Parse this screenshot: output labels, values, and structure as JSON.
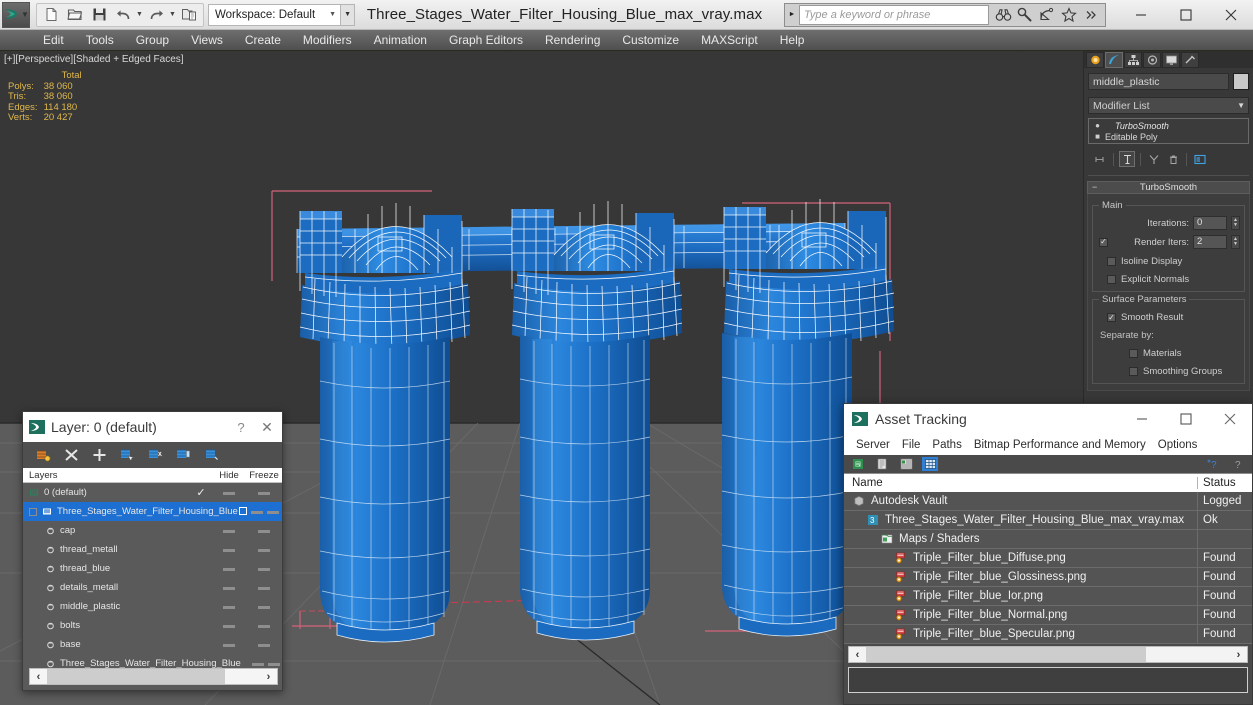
{
  "app": {
    "title": "Three_Stages_Water_Filter_Housing_Blue_max_vray.max",
    "workspace": "Workspace: Default",
    "logo_icon": "max-logo-icon"
  },
  "search": {
    "placeholder": "Type a keyword or phrase",
    "value": "",
    "icons": [
      "binoculars-icon",
      "wrench-icon",
      "satellite-icon",
      "star-icon",
      "more-icon"
    ]
  },
  "window_controls": {
    "minimize": "–",
    "maximize": "□",
    "close": "✕"
  },
  "quick_access": [
    "new-file-icon",
    "open-file-icon",
    "save-icon",
    "undo-icon",
    "redo-icon",
    "set-project-icon"
  ],
  "menubar": {
    "items": [
      "Edit",
      "Tools",
      "Group",
      "Views",
      "Create",
      "Modifiers",
      "Animation",
      "Graph Editors",
      "Rendering",
      "Customize",
      "MAXScript",
      "Help"
    ]
  },
  "viewport": {
    "label": "[+][Perspective][Shaded + Edged Faces]",
    "stats_header": "Total",
    "stats": [
      {
        "key": "Polys:",
        "value": "38 060"
      },
      {
        "key": "Tris:",
        "value": "38 060"
      },
      {
        "key": "Edges:",
        "value": "114 180"
      },
      {
        "key": "Verts:",
        "value": "20 427"
      }
    ],
    "colors": {
      "sky": "#373737",
      "floor": "#5c5c5c",
      "grid": "#6a6a6a",
      "model_blue": "#1f6fc4",
      "wire": "#ffffff",
      "gizmo_pink": "#d1627a"
    }
  },
  "command_panel": {
    "tabs": [
      "create-tab-icon",
      "modify-tab-icon",
      "hierarchy-tab-icon",
      "motion-tab-icon",
      "display-tab-icon",
      "utilities-tab-icon"
    ],
    "active_tab_index": 1,
    "object_name": "middle_plastic",
    "modifier_list_label": "Modifier List",
    "stack": [
      {
        "label": "TurboSmooth",
        "selected": true
      },
      {
        "label": "Editable Poly",
        "selected": false
      }
    ],
    "stack_buttons": [
      "pin-stack-icon",
      "show-end-result-icon",
      "make-unique-icon",
      "remove-modifier-icon",
      "configure-modifier-sets-icon"
    ],
    "rollout": {
      "title": "TurboSmooth",
      "groups": [
        {
          "title": "Main",
          "fields": [
            {
              "label": "Iterations:",
              "value": "0"
            },
            {
              "label": "Render Iters:",
              "value": "2",
              "checkbox": true,
              "checked": true
            }
          ],
          "checkboxes": [
            {
              "label": "Isoline Display",
              "checked": false
            },
            {
              "label": "Explicit Normals",
              "checked": false
            }
          ]
        },
        {
          "title": "Surface Parameters",
          "checkboxes": [
            {
              "label": "Smooth Result",
              "checked": true
            }
          ],
          "text": "Separate by:",
          "sub_checkboxes": [
            {
              "label": "Materials",
              "checked": false
            },
            {
              "label": "Smoothing Groups",
              "checked": false
            }
          ]
        }
      ]
    }
  },
  "layer_dialog": {
    "title": "Layer: 0 (default)",
    "title_icon": "max-layer-icon",
    "help_label": "?",
    "close_label": "✕",
    "toolbar_icons": [
      "new-layer-icon",
      "delete-layer-icon",
      "add-layer-icon",
      "select-objects-in-layer-icon",
      "select-highlighted-objects-icon",
      "highlight-selected-objects-icon",
      "hide-unhide-layer-icon"
    ],
    "columns": {
      "name": "Layers",
      "hide": "Hide",
      "freeze": "Freeze"
    },
    "rows": [
      {
        "label": "0 (default)",
        "indent": 0,
        "selected": false,
        "active_check": true
      },
      {
        "label": "Three_Stages_Water_Filter_Housing_Blue",
        "indent": 0,
        "selected": true,
        "active_check": false
      },
      {
        "label": "cap",
        "indent": 1,
        "selected": false
      },
      {
        "label": "thread_metall",
        "indent": 1,
        "selected": false
      },
      {
        "label": "thread_blue",
        "indent": 1,
        "selected": false
      },
      {
        "label": "details_metall",
        "indent": 1,
        "selected": false
      },
      {
        "label": "middle_plastic",
        "indent": 1,
        "selected": false
      },
      {
        "label": "bolts",
        "indent": 1,
        "selected": false
      },
      {
        "label": "base",
        "indent": 1,
        "selected": false
      },
      {
        "label": "Three_Stages_Water_Filter_Housing_Blue",
        "indent": 1,
        "selected": false
      }
    ],
    "scroll_left": "‹",
    "scroll_right": "›"
  },
  "asset_tracking": {
    "title": "Asset Tracking",
    "title_icon": "max-asset-icon",
    "window_controls": {
      "minimize": "–",
      "maximize": "□",
      "close": "✕"
    },
    "menus": [
      "Server",
      "File",
      "Paths",
      "Bitmap Performance and Memory",
      "Options"
    ],
    "toolbar_icons": [
      "refresh-icon",
      "list-view-icon",
      "detail-view-icon",
      "grid-view-icon"
    ],
    "active_toolbar_index": 3,
    "right_icons": [
      "help-add-icon",
      "help-icon"
    ],
    "columns": {
      "name": "Name",
      "status": "Status"
    },
    "rows": [
      {
        "name": "Autodesk Vault",
        "status": "Logged",
        "indent": 0,
        "icon": "vault-icon"
      },
      {
        "name": "Three_Stages_Water_Filter_Housing_Blue_max_vray.max",
        "status": "Ok",
        "indent": 1,
        "icon": "max-file-icon"
      },
      {
        "name": "Maps / Shaders",
        "status": "",
        "indent": 2,
        "icon": "maps-folder-icon"
      },
      {
        "name": "Triple_Filter_blue_Diffuse.png",
        "status": "Found",
        "indent": 3,
        "icon": "bitmap-icon"
      },
      {
        "name": "Triple_Filter_blue_Glossiness.png",
        "status": "Found",
        "indent": 3,
        "icon": "bitmap-icon"
      },
      {
        "name": "Triple_Filter_blue_Ior.png",
        "status": "Found",
        "indent": 3,
        "icon": "bitmap-icon"
      },
      {
        "name": "Triple_Filter_blue_Normal.png",
        "status": "Found",
        "indent": 3,
        "icon": "bitmap-icon"
      },
      {
        "name": "Triple_Filter_blue_Specular.png",
        "status": "Found",
        "indent": 3,
        "icon": "bitmap-icon"
      }
    ],
    "scroll_left": "‹",
    "scroll_right": "›",
    "status_text": ""
  }
}
